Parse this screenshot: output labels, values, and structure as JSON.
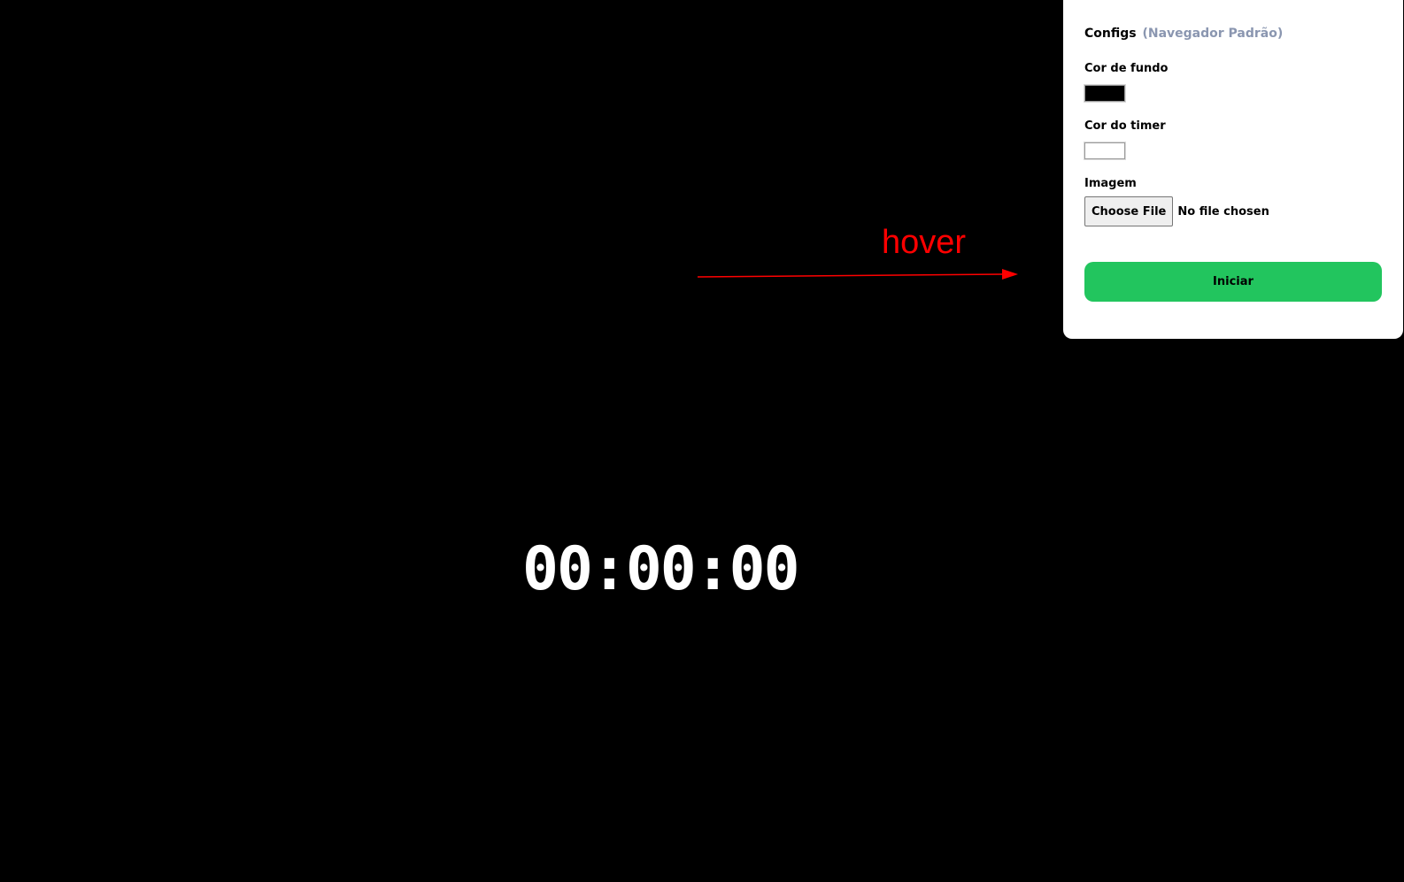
{
  "timer": {
    "display": "00:00:00"
  },
  "annotation": {
    "text": "hover",
    "color": "#ff0000"
  },
  "config_panel": {
    "title": "Configs",
    "subtitle": "(Navegador Padrão)",
    "background_color": {
      "label": "Cor de fundo",
      "value": "#000000"
    },
    "timer_color": {
      "label": "Cor do timer",
      "value": "#ffffff"
    },
    "image": {
      "label": "Imagem",
      "button_label": "Choose File",
      "status": "No file chosen"
    },
    "start_button": {
      "label": "Iniciar",
      "color": "#22c55e"
    }
  },
  "colors": {
    "page_background": "#000000",
    "panel_background": "#ffffff",
    "subtitle": "#8a96b0"
  }
}
